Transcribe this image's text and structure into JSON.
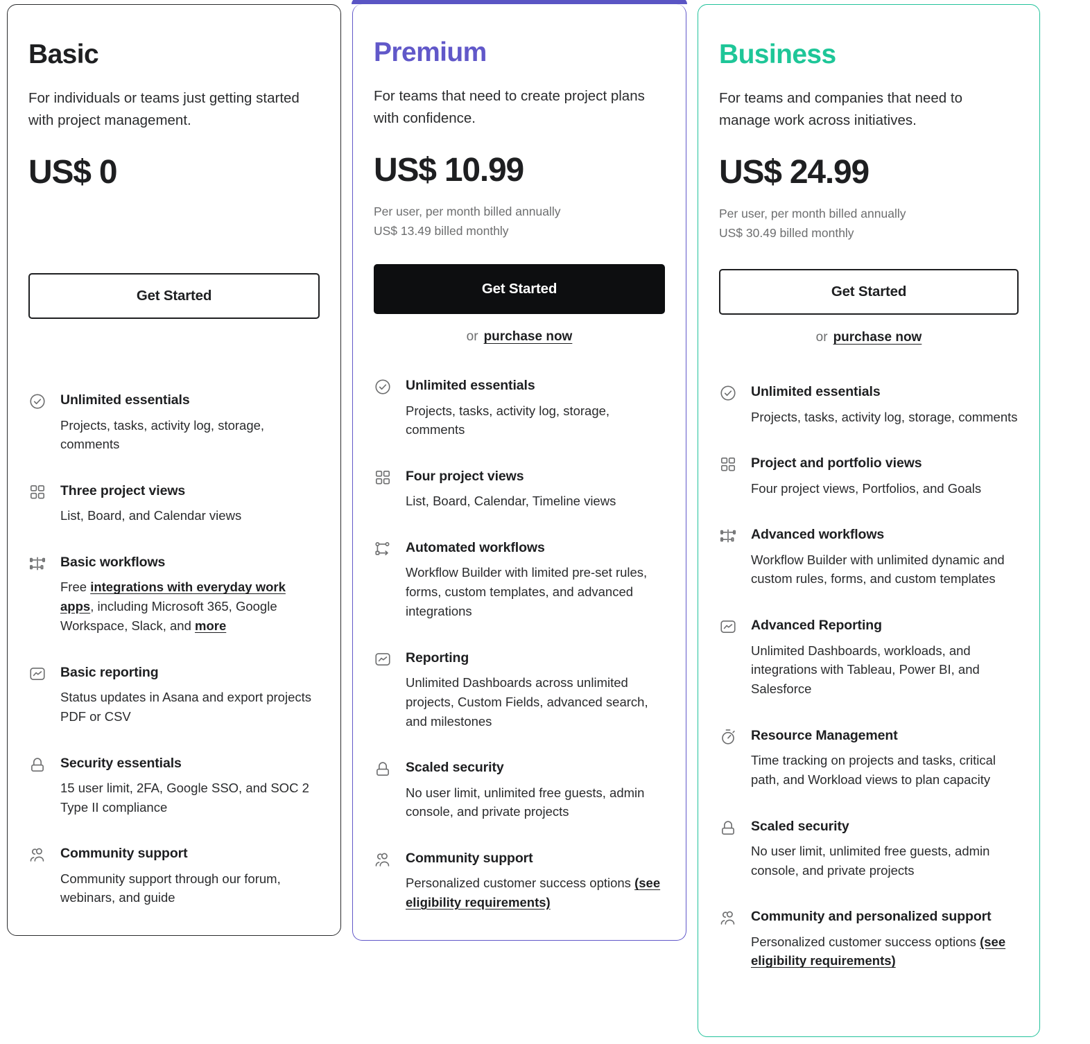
{
  "plans": [
    {
      "id": "basic",
      "name": "Basic",
      "description": "For individuals or teams just getting started with project management.",
      "price": "US$ 0",
      "billing_annual": "",
      "billing_monthly": "",
      "cta_label": "Get Started",
      "cta_style": "outline",
      "has_purchase_link": false,
      "or_text": "",
      "purchase_label": "",
      "accent_color": "#1e1f21",
      "features": [
        {
          "icon": "check-circle-icon",
          "title": "Unlimited essentials",
          "desc_parts": [
            {
              "text": "Projects, tasks, activity log, storage, comments",
              "link": false
            }
          ]
        },
        {
          "icon": "grid-views-icon",
          "title": "Three project views",
          "desc_parts": [
            {
              "text": "List, Board, and Calendar views",
              "link": false
            }
          ]
        },
        {
          "icon": "workflow-branch-icon",
          "title": "Basic workflows",
          "desc_parts": [
            {
              "text": "Free ",
              "link": false
            },
            {
              "text": "integrations with everyday work apps",
              "link": true
            },
            {
              "text": ", including Microsoft 365, Google Workspace, Slack, and ",
              "link": false
            },
            {
              "text": "more",
              "link": true
            }
          ]
        },
        {
          "icon": "reporting-chart-icon",
          "title": "Basic reporting",
          "desc_parts": [
            {
              "text": "Status updates in Asana and export projects PDF or CSV",
              "link": false
            }
          ]
        },
        {
          "icon": "lock-icon",
          "title": "Security essentials",
          "desc_parts": [
            {
              "text": "15 user limit, 2FA, Google SSO, and SOC 2 Type II compliance",
              "link": false
            }
          ]
        },
        {
          "icon": "people-support-icon",
          "title": "Community support",
          "desc_parts": [
            {
              "text": "Community support through our forum, webinars, and guide",
              "link": false
            }
          ]
        }
      ]
    },
    {
      "id": "premium",
      "name": "Premium",
      "description": "For teams that need to create project plans with confidence.",
      "price": "US$ 10.99",
      "billing_annual": "Per user, per month billed annually",
      "billing_monthly": "US$ 13.49 billed monthly",
      "cta_label": "Get Started",
      "cta_style": "solid",
      "has_purchase_link": true,
      "or_text": "or",
      "purchase_label": "purchase now",
      "accent_color": "#6158c9",
      "features": [
        {
          "icon": "check-circle-icon",
          "title": "Unlimited essentials",
          "desc_parts": [
            {
              "text": "Projects, tasks, activity log, storage, comments",
              "link": false
            }
          ]
        },
        {
          "icon": "grid-views-icon",
          "title": "Four project views",
          "desc_parts": [
            {
              "text": "List, Board, Calendar, Timeline views",
              "link": false
            }
          ]
        },
        {
          "icon": "automation-nodes-icon",
          "title": "Automated workflows",
          "desc_parts": [
            {
              "text": "Workflow Builder with limited pre-set rules, forms, custom templates, and advanced integrations",
              "link": false
            }
          ]
        },
        {
          "icon": "reporting-chart-icon",
          "title": "Reporting",
          "desc_parts": [
            {
              "text": "Unlimited Dashboards across unlimited projects, Custom Fields, advanced search, and milestones",
              "link": false
            }
          ]
        },
        {
          "icon": "lock-icon",
          "title": "Scaled security",
          "desc_parts": [
            {
              "text": "No user limit, unlimited free guests, admin console, and private projects",
              "link": false
            }
          ]
        },
        {
          "icon": "people-support-icon",
          "title": "Community support",
          "desc_parts": [
            {
              "text": "Personalized customer success options ",
              "link": false
            },
            {
              "text": "(see eligibility requirements)",
              "link": true
            }
          ]
        }
      ]
    },
    {
      "id": "business",
      "name": "Business",
      "description": "For teams and companies that need to manage work across initiatives.",
      "price": "US$ 24.99",
      "billing_annual": "Per user, per month billed annually",
      "billing_monthly": "US$ 30.49 billed monthly",
      "cta_label": "Get Started",
      "cta_style": "outline",
      "has_purchase_link": true,
      "or_text": "or",
      "purchase_label": "purchase now",
      "accent_color": "#1ec698",
      "features": [
        {
          "icon": "check-circle-icon",
          "title": "Unlimited essentials",
          "desc_parts": [
            {
              "text": "Projects, tasks, activity log, storage, comments",
              "link": false
            }
          ]
        },
        {
          "icon": "grid-views-icon",
          "title": "Project and portfolio views",
          "desc_parts": [
            {
              "text": "Four project views, Portfolios, and Goals",
              "link": false
            }
          ]
        },
        {
          "icon": "workflow-branch-icon",
          "title": "Advanced workflows",
          "desc_parts": [
            {
              "text": "Workflow Builder with unlimited dynamic and custom rules, forms, and custom templates",
              "link": false
            }
          ]
        },
        {
          "icon": "reporting-chart-icon",
          "title": "Advanced Reporting",
          "desc_parts": [
            {
              "text": "Unlimited Dashboards, workloads, and integrations with Tableau, Power BI, and Salesforce",
              "link": false
            }
          ]
        },
        {
          "icon": "stopwatch-icon",
          "title": "Resource Management",
          "desc_parts": [
            {
              "text": "Time tracking on projects and tasks, critical path, and Workload views to plan capacity",
              "link": false
            }
          ]
        },
        {
          "icon": "lock-icon",
          "title": "Scaled security",
          "desc_parts": [
            {
              "text": "No user limit, unlimited free guests, admin console, and private projects",
              "link": false
            }
          ]
        },
        {
          "icon": "people-support-icon",
          "title": "Community and personalized support",
          "desc_parts": [
            {
              "text": "Personalized customer success options ",
              "link": false
            },
            {
              "text": "(see eligibility requirements)",
              "link": true
            }
          ]
        }
      ]
    }
  ]
}
